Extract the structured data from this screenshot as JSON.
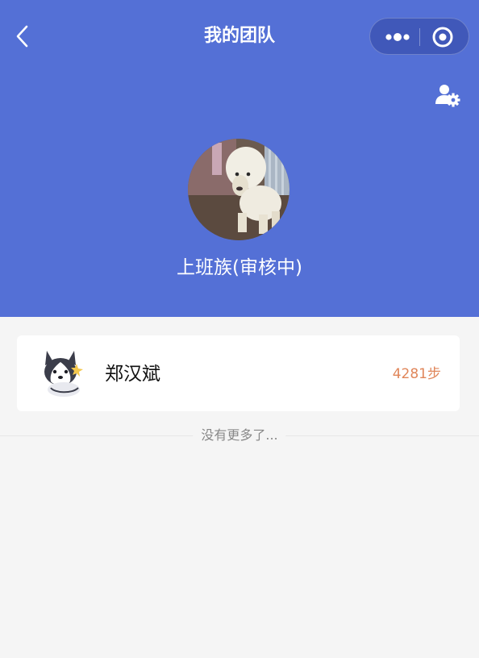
{
  "nav": {
    "title": "我的团队"
  },
  "team": {
    "name": "上班族(审核中)"
  },
  "members": [
    {
      "name": "郑汉斌",
      "steps": "4281步"
    }
  ],
  "footer": {
    "no_more_text": "没有更多了..."
  },
  "colors": {
    "header_bg": "#5470d6",
    "steps_text": "#e0865a",
    "page_bg": "#f5f5f5"
  },
  "icons": {
    "back": "chevron-left-icon",
    "more": "more-dots-icon",
    "close": "target-close-icon",
    "settings": "user-settings-icon"
  }
}
